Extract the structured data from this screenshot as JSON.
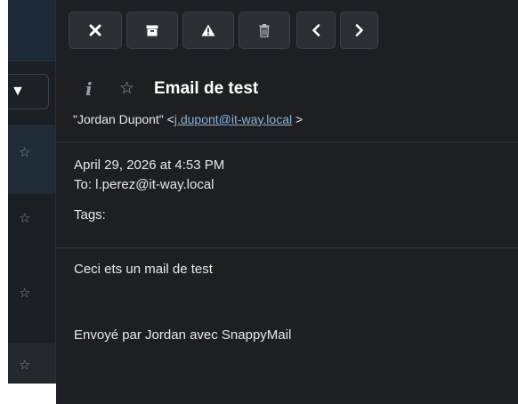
{
  "toolbar": {
    "buttons": [
      {
        "name": "close",
        "icon": "close-x-icon"
      },
      {
        "name": "archive",
        "icon": "archive-box-icon"
      },
      {
        "name": "spam",
        "icon": "warning-triangle-icon"
      },
      {
        "name": "delete",
        "icon": "trash-icon"
      },
      {
        "name": "previous",
        "icon": "chevron-left-icon"
      },
      {
        "name": "next",
        "icon": "chevron-right-icon"
      }
    ]
  },
  "message_list": {
    "dropdown_caret": "▼",
    "star_glyph": "☆",
    "visible_rows": 4
  },
  "message": {
    "info_icon": "i",
    "star_glyph": "☆",
    "subject": "Email de test",
    "sender_name": "\"Jordan Dupont\" <",
    "sender_email": "j.dupont@it-way.local",
    "sender_suffix": ">",
    "date": "April 29, 2026 at 4:53 PM",
    "to": "To: l.perez@it-way.local",
    "tags": "Tags:",
    "body": [
      "Ceci ets un mail de test",
      "Envoyé par Jordan avec SnappyMail"
    ]
  },
  "colors": {
    "pane_background": "#1d1f22",
    "list_background": "#1b1e22",
    "selected_row": "#1f2b36",
    "link": "#8ab4d8",
    "text": "#e6e8ea",
    "muted": "#9aa0a6"
  }
}
